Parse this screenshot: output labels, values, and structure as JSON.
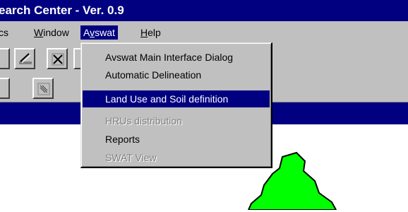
{
  "window": {
    "title": "earch Center - Ver. 0.9"
  },
  "menubar": {
    "items": [
      {
        "label": "cs"
      },
      {
        "label": "Window"
      },
      {
        "label": "Avswat"
      },
      {
        "label": "Help"
      }
    ]
  },
  "dropdown": {
    "items": [
      {
        "label": "Avswat Main Interface Dialog",
        "state": "enabled"
      },
      {
        "label": "Automatic Delineation",
        "state": "enabled"
      },
      {
        "label": "Land Use and Soil definition",
        "state": "selected"
      },
      {
        "label": "HRUs distribution",
        "state": "disabled"
      },
      {
        "label": "Reports",
        "state": "enabled"
      },
      {
        "label": "SWAT View",
        "state": "disabled"
      }
    ]
  },
  "toolbar": {
    "help_button_icon": "context-help-icon"
  },
  "colors": {
    "title_bg": "#000080",
    "face": "#c0c0c0",
    "highlight": "#000080",
    "map_fill": "#00ff00"
  }
}
